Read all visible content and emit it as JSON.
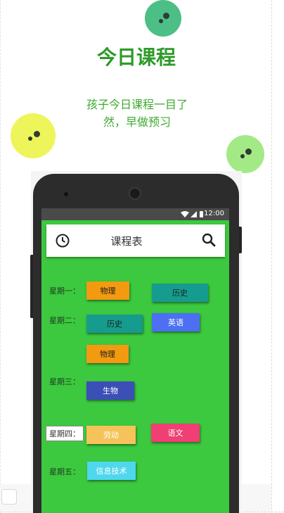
{
  "promo": {
    "title": "今日课程",
    "subtitle": "孩子今日课程一目了然，早做预习"
  },
  "status_bar": {
    "time": "12:00"
  },
  "app_bar": {
    "title": "课程表",
    "left_icon": "clock-icon",
    "right_icon": "search-icon"
  },
  "days": [
    {
      "label": "星期一："
    },
    {
      "label": "星期二："
    },
    {
      "label": "星期三："
    },
    {
      "label": "星期四："
    },
    {
      "label": "星期五："
    }
  ],
  "courses": [
    {
      "label": "物理",
      "color": "#f39a10"
    },
    {
      "label": "历史",
      "color": "#169c8e"
    },
    {
      "label": "历史",
      "color": "#169c8e"
    },
    {
      "label": "英语",
      "color": "#4d70f2"
    },
    {
      "label": "物理",
      "color": "#f39a10"
    },
    {
      "label": "生物",
      "color": "#3b4fb6"
    },
    {
      "label": "劳动",
      "color": "#f6c35a"
    },
    {
      "label": "语文",
      "color": "#ef3f73"
    },
    {
      "label": "信息技术",
      "color": "#4fd7ee"
    }
  ],
  "colors": {
    "screen_bg": "#3cc83f",
    "title_green": "#2e9a2a",
    "bubble_top": "#4cbf86",
    "bubble_left": "#eef55a",
    "bubble_right": "#a3ea86"
  }
}
